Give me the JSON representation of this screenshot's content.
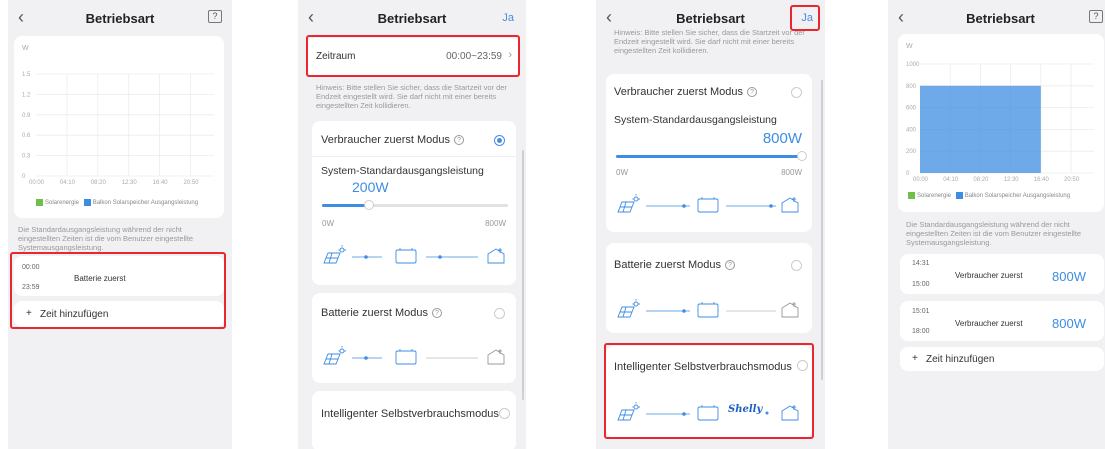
{
  "common": {
    "title": "Betriebsart",
    "back_icon": "chevron-left-icon",
    "help_icon": "question-box-icon",
    "confirm_label": "Ja"
  },
  "chart": {
    "y_unit": "W",
    "legend_solar": "Solarenergie",
    "legend_balcony": "Balkon Solarspeicher Ausgangsleistung",
    "x_ticks": [
      "00:00",
      "04:10",
      "08:20",
      "12:30",
      "16:40",
      "20:50"
    ],
    "colors": {
      "solar": "#6ec04a",
      "balcony": "#3d8de3"
    }
  },
  "screen1": {
    "chart_data": {
      "type": "area",
      "ylabel": "W",
      "yticks": [
        "1.5",
        "1.2",
        "0.9",
        "0.6",
        "0.3",
        "0"
      ],
      "xticks": [
        "00:00",
        "04:10",
        "08:20",
        "12:30",
        "16:40",
        "20:50"
      ],
      "ylim": [
        0,
        1.5
      ],
      "series": []
    },
    "note": "Die Standardausgangsleistung während der nicht eingestellten Zeiten ist die vom Benutzer eingestellte Systemausgangsleistung.",
    "entry": {
      "start": "00:00",
      "end": "23:59",
      "label": "Batterie zuerst"
    },
    "add_label": "Zeit hinzufügen"
  },
  "screen2": {
    "period_label": "Zeitraum",
    "period_value": "00:00~23:59",
    "hint": "Hinweis: Bitte stellen Sie sicher, dass die Startzeit vor der Endzeit eingestellt wird. Sie darf nicht mit einer bereits eingestellten Zeit kollidieren.",
    "mode1": "Verbraucher zuerst Modus",
    "sys_label": "System-Standardausgangsleistung",
    "sys_value": "200W",
    "slider_min": "0W",
    "slider_max": "800W",
    "slider_fraction": 0.25,
    "mode2": "Batterie zuerst Modus",
    "mode3": "Intelligenter Selbstverbrauchsmodus"
  },
  "screen3": {
    "hint": "Hinweis: Bitte stellen Sie sicher, dass die Startzeit vor der Endzeit eingestellt wird. Sie darf nicht mit einer bereits eingestellten Zeit kollidieren.",
    "mode1": "Verbraucher zuerst Modus",
    "sys_label": "System-Standardausgangsleistung",
    "sys_value": "800W",
    "slider_min": "0W",
    "slider_max": "800W",
    "slider_fraction": 1.0,
    "mode2": "Batterie zuerst Modus",
    "mode3": "Intelligenter Selbstverbrauchsmodus",
    "shelly_label": "Shelly"
  },
  "screen4": {
    "chart_data": {
      "type": "area",
      "ylabel": "W",
      "yticks": [
        "1000",
        "800",
        "600",
        "400",
        "200",
        "0"
      ],
      "xticks": [
        "00:00",
        "04:10",
        "08:20",
        "12:30",
        "16:40",
        "20:50"
      ],
      "ylim": [
        0,
        1000
      ],
      "series": [
        {
          "name": "Balkon Solarspeicher Ausgangsleistung",
          "x_start": "00:00",
          "x_end": "16:40",
          "value": 800
        }
      ]
    },
    "note": "Die Standardausgangsleistung während der nicht eingestellten Zeiten ist die vom Benutzer eingestellte Systemausgangsleistung.",
    "entries": [
      {
        "start": "14:31",
        "end": "15:00",
        "label": "Verbraucher zuerst",
        "value": "800W"
      },
      {
        "start": "15:01",
        "end": "18:00",
        "label": "Verbraucher zuerst",
        "value": "800W"
      }
    ],
    "add_label": "Zeit hinzufügen"
  }
}
